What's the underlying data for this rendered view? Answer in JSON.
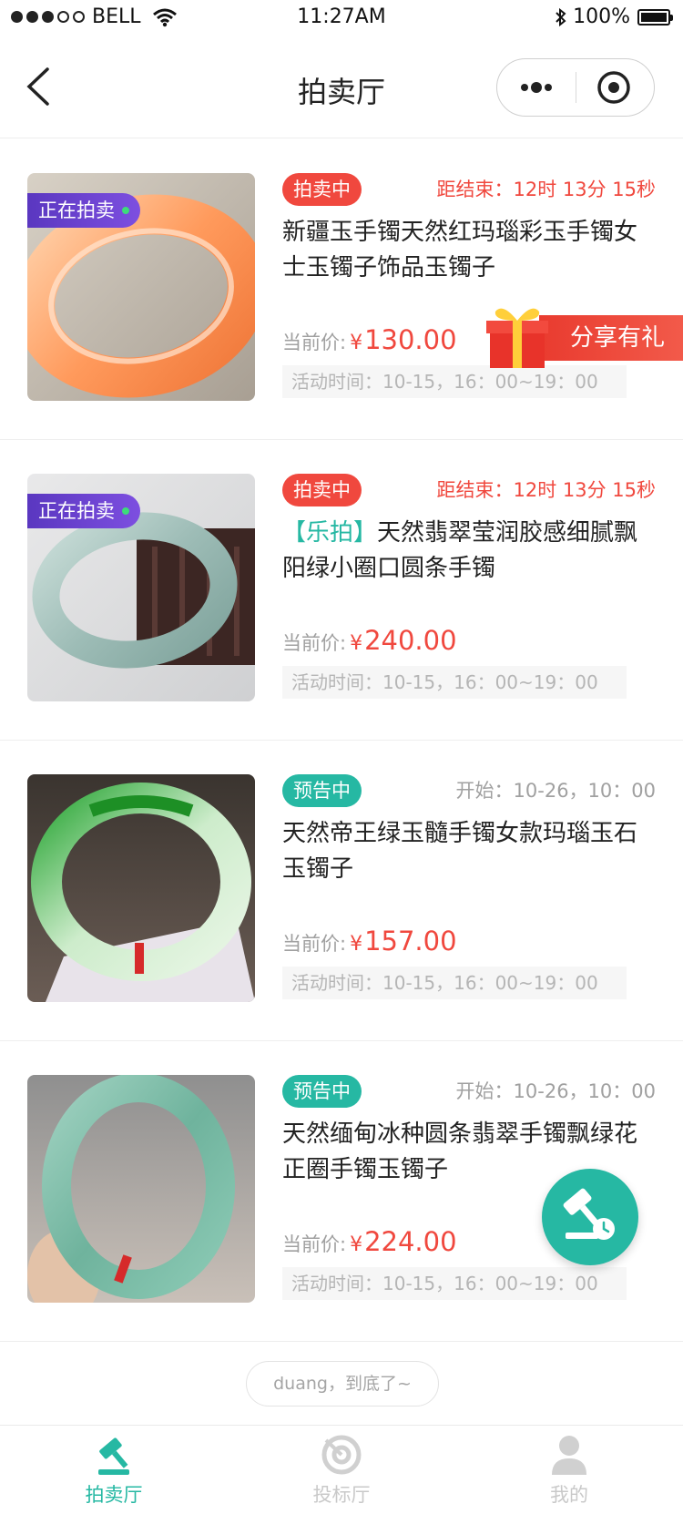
{
  "status_bar": {
    "carrier": "BELL",
    "time": "11:27AM",
    "battery": "100%"
  },
  "nav": {
    "title": "拍卖厅"
  },
  "live_badge_text": "正在拍卖",
  "items": [
    {
      "tag": "拍卖中",
      "tag_type": "live",
      "time_info": "距结束：12时 13分 15秒",
      "brand": "",
      "title": "新疆玉手镯天然红玛瑙彩玉手镯女士玉镯子饰品玉镯子",
      "price_label": "当前价:",
      "currency": "¥",
      "price": "130.00",
      "activity_time": "活动时间：10-15，16：00~19：00",
      "live": true,
      "share": "分享有礼"
    },
    {
      "tag": "拍卖中",
      "tag_type": "live",
      "time_info": "距结束：12时 13分 15秒",
      "brand": "【乐拍】",
      "title": "天然翡翠莹润胶感细腻飘阳绿小圈口圆条手镯",
      "price_label": "当前价:",
      "currency": "¥",
      "price": "240.00",
      "activity_time": "活动时间：10-15，16：00~19：00",
      "live": true
    },
    {
      "tag": "预告中",
      "tag_type": "pre",
      "time_info": "开始：10-26，10：00",
      "brand": "",
      "title": "天然帝王绿玉髓手镯女款玛瑙玉石玉镯子",
      "price_label": "当前价:",
      "currency": "¥",
      "price": "157.00",
      "activity_time": "活动时间：10-15，16：00~19：00",
      "live": false
    },
    {
      "tag": "预告中",
      "tag_type": "pre",
      "time_info": "开始：10-26，10：00",
      "brand": "",
      "title": "天然缅甸冰种圆条翡翠手镯飘绿花正圈手镯玉镯子",
      "price_label": "当前价:",
      "currency": "¥",
      "price": "224.00",
      "activity_time": "活动时间：10-15，16：00~19：00",
      "live": false
    }
  ],
  "end_text": "duang，到底了~",
  "tabs": [
    {
      "label": "拍卖厅",
      "icon": "auction-hammer-icon",
      "active": true
    },
    {
      "label": "投标厅",
      "icon": "target-icon",
      "active": false
    },
    {
      "label": "我的",
      "icon": "user-icon",
      "active": false
    }
  ],
  "colors": {
    "accent": "#26b8a3",
    "price": "#f0483e",
    "live_badge": "#6a43d0"
  }
}
